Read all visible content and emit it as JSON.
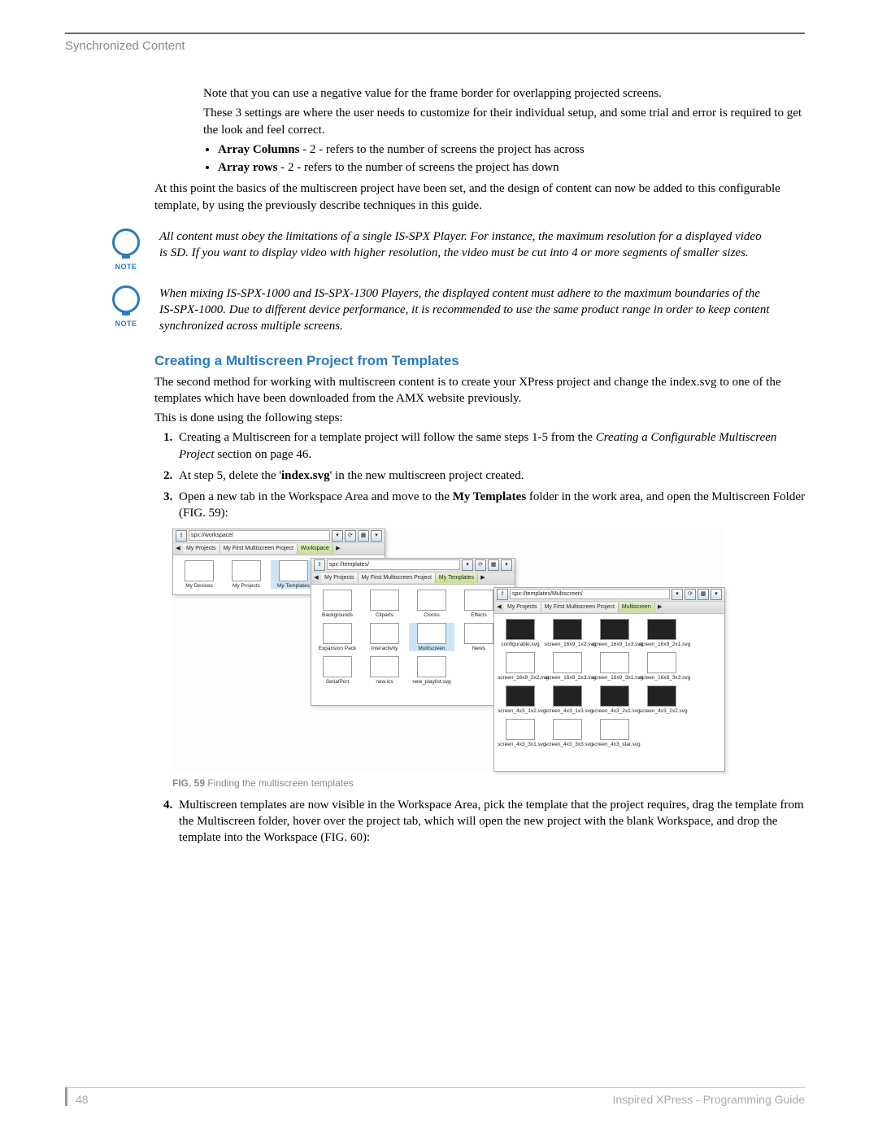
{
  "header": "Synchronized Content",
  "intro": {
    "p1": "Note that you can use a negative value for the frame border for overlapping projected screens.",
    "p2": "These 3 settings are where the user needs to customize for their individual setup, and some trial and error is required to get the look and feel correct.",
    "b1_label": "Array Columns",
    "b1_rest": " - 2 - refers to the number of screens the project has across",
    "b2_label": "Array rows",
    "b2_rest": " - 2 - refers to the number of screens the project has down",
    "p3": "At this point the basics of the multiscreen project have been set, and the design of content can now be added to this configurable template, by using the previously describe techniques in this guide."
  },
  "notes": {
    "label": "NOTE",
    "n1": "All content must obey the limitations of a single IS-SPX Player. For instance, the maximum resolution for a displayed video is SD. If you want to display video with higher resolution, the video must be cut into 4 or more segments of smaller sizes.",
    "n2": "When mixing IS-SPX-1000 and IS-SPX-1300 Players, the displayed content must adhere to the maximum boundaries of the IS-SPX-1000. Due to different device performance, it is recommended to use the same product range in order to keep content synchronized across multiple screens."
  },
  "section": {
    "heading": "Creating a Multiscreen Project from Templates",
    "p1": "The second method for working with multiscreen content is to create your XPress project and change the index.svg to one of the templates which have been downloaded from the AMX website previously.",
    "p2": "This is done using the following steps:",
    "s1_a": "Creating a Multiscreen for a template project will follow the same steps 1-5 from the ",
    "s1_em": "Creating a Configurable Multiscreen Project",
    "s1_b": " section on page 46.",
    "s2_a": "At step 5, delete the '",
    "s2_b": "index.svg",
    "s2_c": "' in the new multiscreen project created.",
    "s3_a": "Open a new tab in the Workspace Area and move to the ",
    "s3_b": "My Templates",
    "s3_c": " folder in the work area, and open the Multiscreen Folder (FIG. 59):",
    "s4": "Multiscreen templates are now visible in the Workspace Area, pick the template that the project requires, drag the template from the Multiscreen folder, hover over the project tab, which will open the new project with the blank Workspace, and drop the template into the Workspace (FIG. 60):"
  },
  "figure": {
    "caption_label": "FIG. 59",
    "caption_text": "  Finding the multiscreen templates",
    "panel1": {
      "addr": "spx://workspace/",
      "tabs": [
        "My Projects",
        "My First Multiscreen Project",
        "Workspace"
      ],
      "items": [
        "My Devices",
        "My Projects",
        "My Templates"
      ]
    },
    "panel2": {
      "addr": "spx://templates/",
      "tabs": [
        "My Projects",
        "My First Multiscreen Project",
        "My Templates"
      ],
      "items": [
        "Backgrounds",
        "Cliparts",
        "Clocks",
        "Effects",
        "Expansion Pack",
        "Interactivity",
        "Multiscreen",
        "News",
        "SerialPort",
        "new.ics",
        "new_playlist.svg"
      ]
    },
    "panel3": {
      "addr": "spx://templates/Multiscreen/",
      "tabs": [
        "My Projects",
        "My First Multiscreen Project",
        "Multiscreen"
      ],
      "items": [
        "configurable.svg",
        "screen_16x9_1x2.svg",
        "screen_16x9_1x3.svg",
        "screen_16x9_2x1.svg",
        "screen_16x9_2x2.svg",
        "screen_16x9_2x3.svg",
        "screen_16x9_3x1.svg",
        "screen_16x9_3x3.svg",
        "screen_4x3_1x2.svg",
        "screen_4x3_1x3.svg",
        "screen_4x3_2x1.svg",
        "screen_4x3_2x2.svg",
        "screen_4x3_3x1.svg",
        "screen_4x3_3x3.svg",
        "screen_4x3_star.svg"
      ]
    }
  },
  "footer": {
    "page": "48",
    "title": "Inspired XPress - Programming Guide"
  }
}
